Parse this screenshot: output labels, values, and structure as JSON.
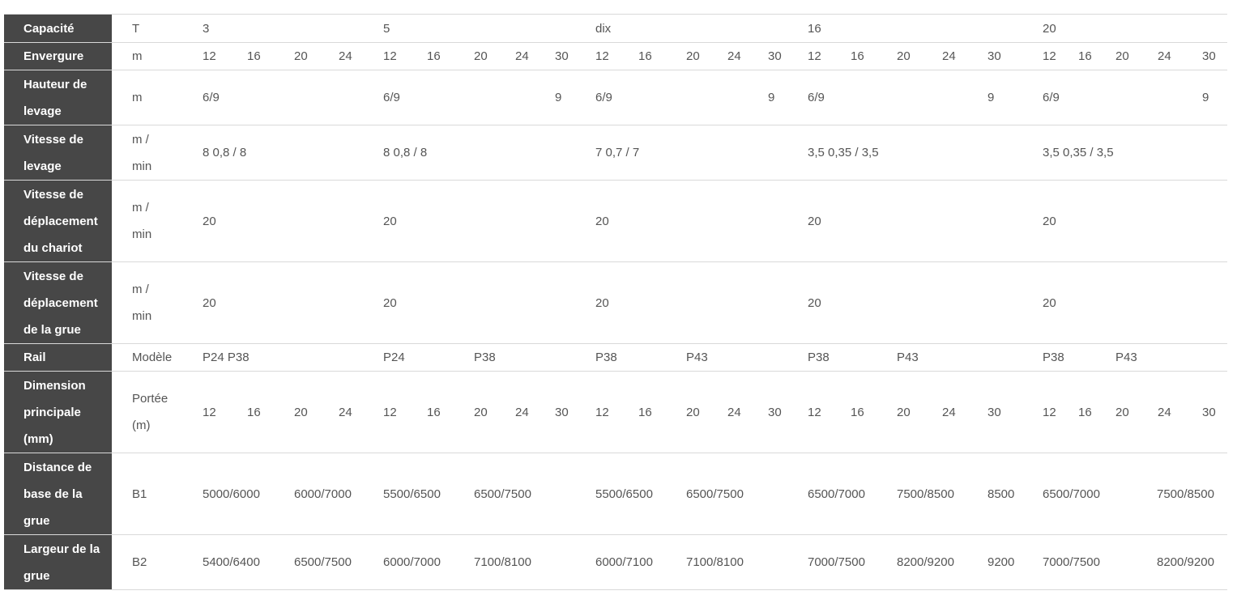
{
  "table": {
    "rows": [
      {
        "header": "Capacité",
        "unit": "T",
        "cells": [
          "3",
          "5",
          "dix",
          "16",
          "20"
        ]
      },
      {
        "header": "Envergure",
        "unit": "m",
        "cells": [
          "12",
          "16",
          "20",
          "24",
          "12",
          "16",
          "20",
          "24",
          "30",
          "12",
          "16",
          "20",
          "24",
          "30",
          "12",
          "16",
          "20",
          "24",
          "30",
          "12",
          "16",
          "20",
          "24",
          "30"
        ]
      },
      {
        "header": "Hauteur de levage",
        "unit": "m",
        "cells": [
          "6/9",
          "6/9",
          "9",
          "6/9",
          "9",
          "6/9",
          "9",
          "6/9",
          "9"
        ]
      },
      {
        "header": "Vitesse de levage",
        "unit": "m / min",
        "cells": [
          "8 0,8 / 8",
          "8 0,8 / 8",
          "7 0,7 / 7",
          "3,5 0,35 / 3,5",
          "3,5 0,35 / 3,5"
        ]
      },
      {
        "header": "Vitesse de déplacement du chariot",
        "unit": "m / min",
        "cells": [
          "20",
          "20",
          "20",
          "20",
          "20"
        ]
      },
      {
        "header": "Vitesse de déplacement de la grue",
        "unit": "m / min",
        "cells": [
          "20",
          "20",
          "20",
          "20",
          "20"
        ]
      },
      {
        "header": "Rail",
        "unit": "Modèle",
        "cells": [
          "P24 P38",
          "P24",
          "P38",
          "P38",
          "P43",
          "P38",
          "P43",
          "P38",
          "P43"
        ]
      },
      {
        "header": "Dimension principale (mm)",
        "unit": "Portée (m)",
        "cells": [
          "12",
          "16",
          "20",
          "24",
          "12",
          "16",
          "20",
          "24",
          "30",
          "12",
          "16",
          "20",
          "24",
          "30",
          "12",
          "16",
          "20",
          "24",
          "30",
          "12",
          "16",
          "20",
          "24",
          "30"
        ]
      },
      {
        "header": "Distance de base de la grue",
        "unit": "B1",
        "cells": [
          "5000/6000",
          "6000/7000",
          "5500/6500",
          "6500/7500",
          "5500/6500",
          "6500/7500",
          "6500/7000",
          "7500/8500",
          "8500",
          "6500/7000",
          "7500/8500"
        ]
      },
      {
        "header": "Largeur de la grue",
        "unit": "B2",
        "cells": [
          "5400/6400",
          "6500/7500",
          "6000/7000",
          "7100/8100",
          "6000/7100",
          "7100/8100",
          "7000/7500",
          "8200/9200",
          "9200",
          "7000/7500",
          "8200/9200"
        ]
      }
    ]
  }
}
